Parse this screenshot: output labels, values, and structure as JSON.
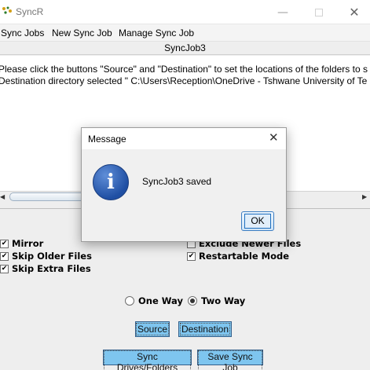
{
  "window": {
    "title": "SyncR",
    "min_label": "—",
    "close_label": "✕"
  },
  "menu": [
    "Sync Jobs",
    "New Sync Job",
    "Manage Sync Job"
  ],
  "job_header": "SyncJob3",
  "log_lines": [
    "Please click the buttons \"Source\" and \"Destination\" to set the locations of the folders to s",
    "Destination directory selected \" C:\\Users\\Reception\\OneDrive - Tshwane University of Te"
  ],
  "options_left": [
    {
      "label": "Mirror",
      "checked": true
    },
    {
      "label": "Skip Older Files",
      "checked": true
    },
    {
      "label": "Skip Extra Files",
      "checked": true
    }
  ],
  "options_right": [
    {
      "label": "Exclude Newer Files",
      "checked": false
    },
    {
      "label": "Restartable Mode",
      "checked": true
    }
  ],
  "sync_mode": {
    "options": [
      "One Way",
      "Two Way"
    ],
    "selected": "Two Way"
  },
  "buttons": {
    "source": "Source",
    "destination": "Destination",
    "sync": "Sync Drives/Folders",
    "save": "Save Sync Job"
  },
  "dialog": {
    "title": "Message",
    "close_label": "✕",
    "message": "SyncJob3 saved",
    "ok": "OK",
    "icon": "info-icon"
  },
  "colors": {
    "button_blue": "#7ec5ef",
    "info_blue": "#1f4fa3"
  }
}
